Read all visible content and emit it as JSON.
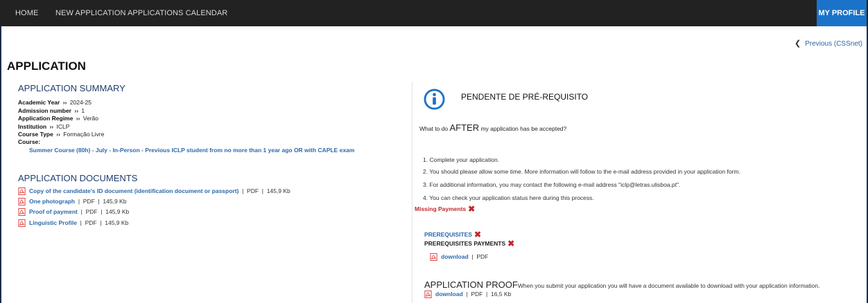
{
  "nav": {
    "home": "HOME",
    "new_application": "NEW APPLICATION",
    "applications_calendar": "APPLICATIONS CALENDAR",
    "my_profile": "MY PROFILE"
  },
  "previous_link": "Previous (CSSnet)",
  "page_title": "APPLICATION",
  "summary": {
    "title": "APPLICATION SUMMARY",
    "separator": "››",
    "items": [
      {
        "label": "Academic Year",
        "value": "2024-25"
      },
      {
        "label": "Admission number",
        "value": "1"
      },
      {
        "label": "Application Regime",
        "value": "Verão"
      },
      {
        "label": "Institution",
        "value": "ICLP"
      },
      {
        "label": "Course Type",
        "value": "Formação Livre"
      }
    ],
    "course_label": "Course:",
    "course_value": "Summer Course (80h) - July - In-Person - Previous ICLP student from no more than 1 year ago OR with CAPLE exam"
  },
  "documents": {
    "title": "APPLICATION DOCUMENTS",
    "items": [
      {
        "name": "Copy of the candidate's ID document (identification document or passport)",
        "type": "PDF",
        "size": "145,9 Kb"
      },
      {
        "name": "One photograph",
        "type": "PDF",
        "size": "145,9 Kb"
      },
      {
        "name": "Proof of payment",
        "type": "PDF",
        "size": "145,9 Kb"
      },
      {
        "name": "Linguistic Profile",
        "type": "PDF",
        "size": "145,9 Kb"
      }
    ]
  },
  "status": {
    "title": "PENDENTE DE PRÉ-REQUISITO",
    "after_prefix": "What to do ",
    "after_big": "AFTER",
    "after_suffix": " my application has be accepted?",
    "steps": [
      "1. Complete your application.",
      "2. You should please allow some time. More information will follow to the e-mail address provided in your application form.",
      "3. For additional information, you may contact the following e-mail address \"iclp@letras.ulisboa.pt\".",
      "4. You can check your application status here during this process."
    ],
    "missing_payments": "Missing Payments",
    "prerequisites": "PREREQUISITES",
    "prerequisites_payments": "PREREQUISITES PAYMENTS",
    "prereq_download": {
      "label": "download",
      "type": "PDF"
    },
    "proof_title": "APPLICATION PROOF",
    "proof_text": "When you submit your application you will have a document available to download with your application information.",
    "proof_download": {
      "label": "download",
      "type": "PDF",
      "size": "16,5 Kb"
    }
  },
  "colors": {
    "navbar": "#222222",
    "profile_accent": "#1a73c9",
    "link": "#2d69ad",
    "error": "#c0282e"
  }
}
